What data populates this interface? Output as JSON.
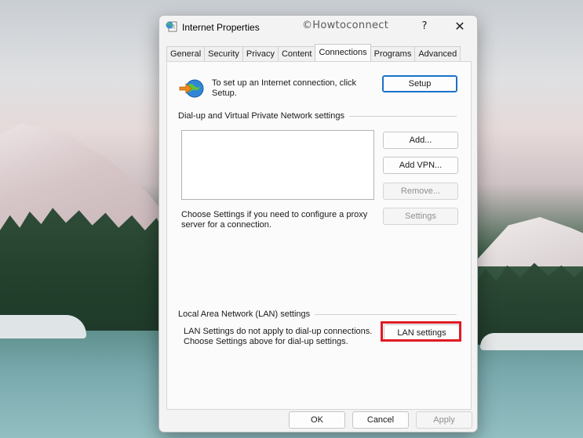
{
  "dialog": {
    "title": "Internet Properties",
    "watermark": "©Howtoconnect",
    "help_label": "?",
    "close_label": "✕"
  },
  "tabs": [
    {
      "label": "General"
    },
    {
      "label": "Security"
    },
    {
      "label": "Privacy"
    },
    {
      "label": "Content"
    },
    {
      "label": "Connections",
      "active": true
    },
    {
      "label": "Programs"
    },
    {
      "label": "Advanced"
    }
  ],
  "setup": {
    "text": "To set up an Internet connection, click Setup.",
    "button_label": "Setup"
  },
  "dialup": {
    "section_label": "Dial-up and Virtual Private Network settings",
    "add_label": "Add...",
    "add_vpn_label": "Add VPN...",
    "remove_label": "Remove...",
    "settings_label": "Settings",
    "proxy_text": "Choose Settings if you need to configure a proxy server for a connection."
  },
  "lan": {
    "section_label": "Local Area Network (LAN) settings",
    "text": "LAN Settings do not apply to dial-up connections. Choose Settings above for dial-up settings.",
    "button_label": "LAN settings"
  },
  "footer": {
    "ok_label": "OK",
    "cancel_label": "Cancel",
    "apply_label": "Apply"
  },
  "icons": {
    "title_icon": "internet-options-icon",
    "setup_icon": "globe-arrow-icon"
  },
  "colors": {
    "accent": "#1a73c9",
    "highlight": "#e01b24"
  }
}
